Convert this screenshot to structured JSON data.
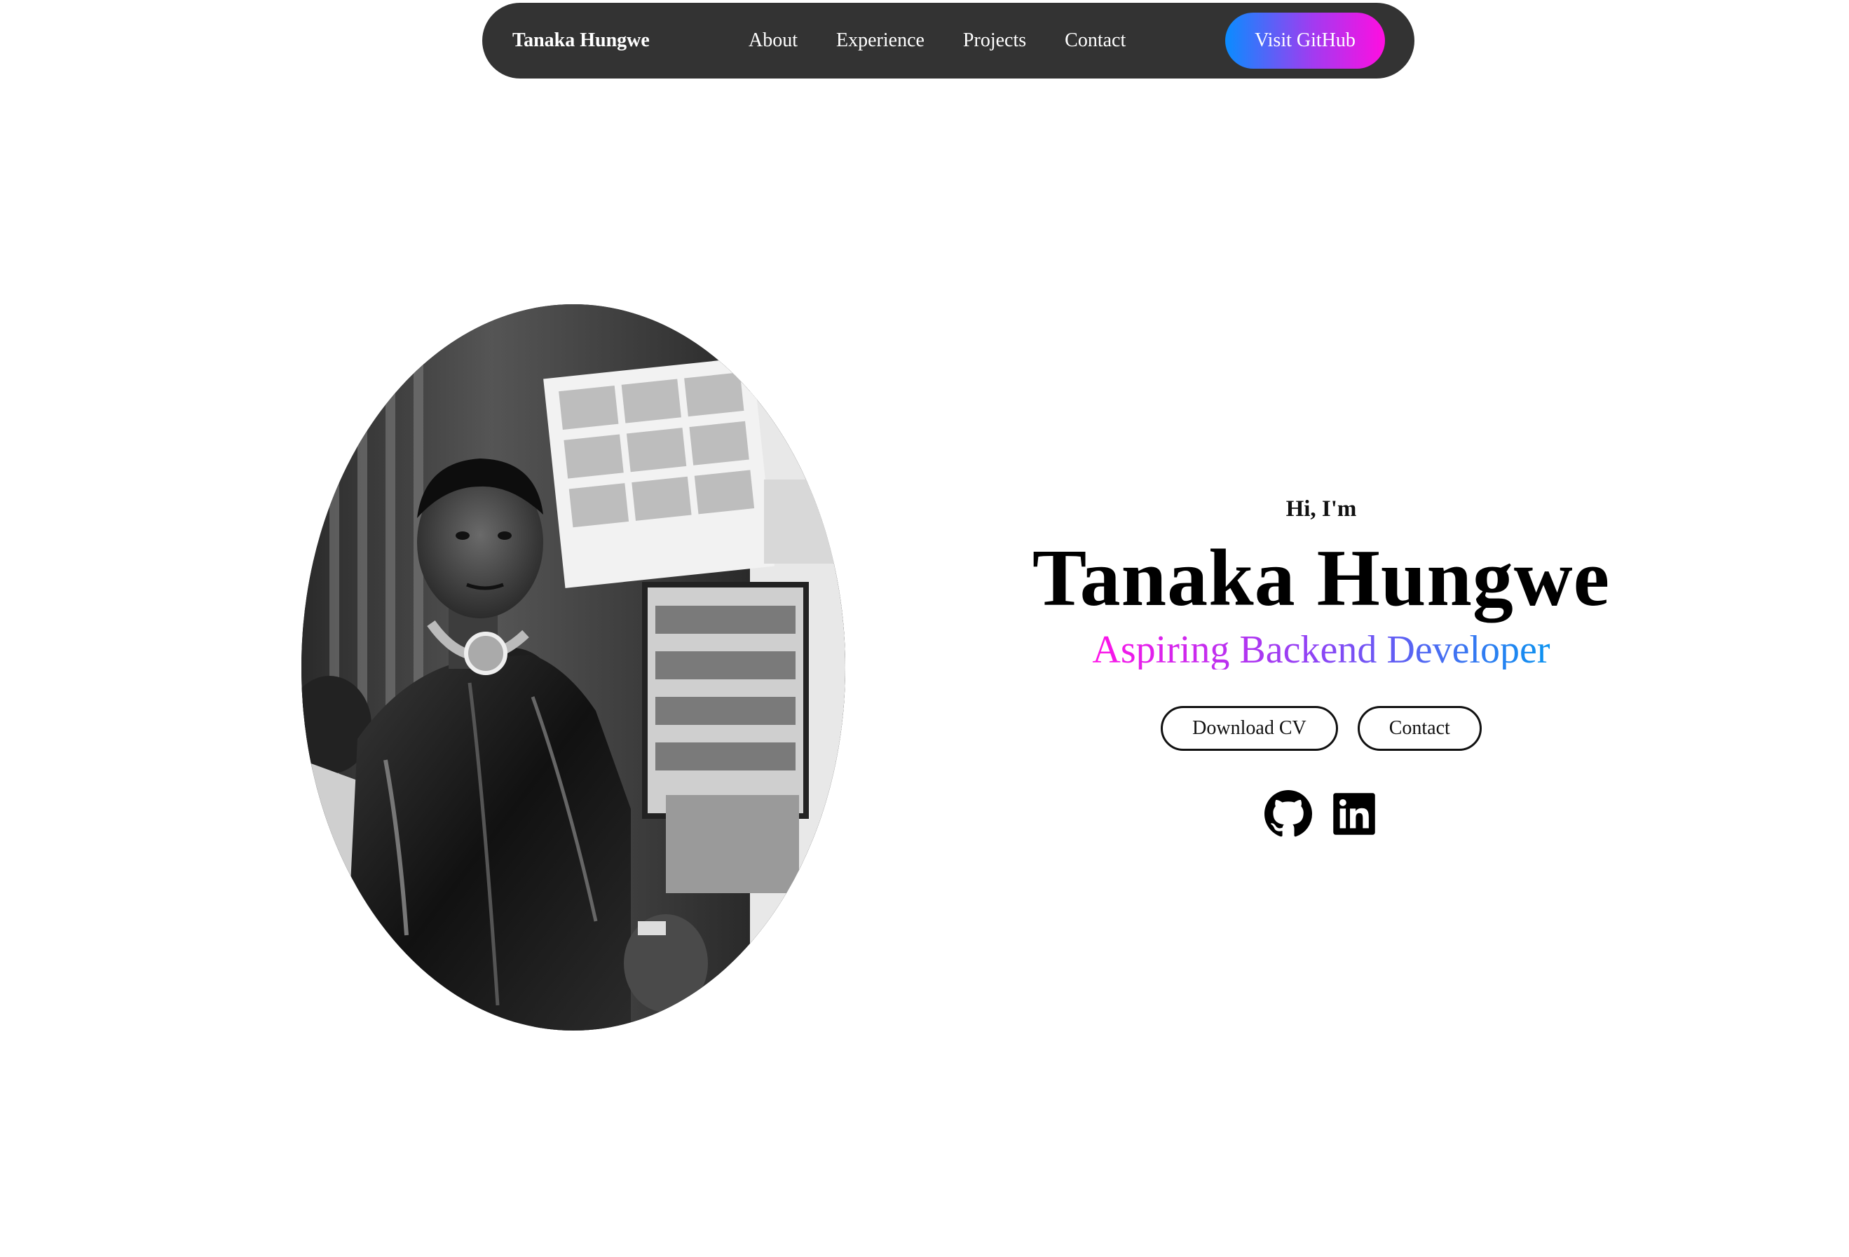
{
  "nav": {
    "brand": "Tanaka Hungwe",
    "links": [
      "About",
      "Experience",
      "Projects",
      "Contact"
    ],
    "cta_label": "Visit GitHub",
    "cta_gradient": [
      "#0a8cff",
      "#ff0ee0"
    ],
    "background": "#333333"
  },
  "profile": {
    "image_icon": "profile-photo"
  },
  "hero": {
    "greeting": "Hi, I'm",
    "name": "Tanaka Hungwe",
    "role": "Aspiring Backend Developer",
    "role_gradient": [
      "#ff13e8",
      "#0a93f0"
    ],
    "buttons": {
      "download_cv": "Download CV",
      "contact": "Contact"
    },
    "socials": [
      "github-icon",
      "linkedin-icon"
    ]
  }
}
